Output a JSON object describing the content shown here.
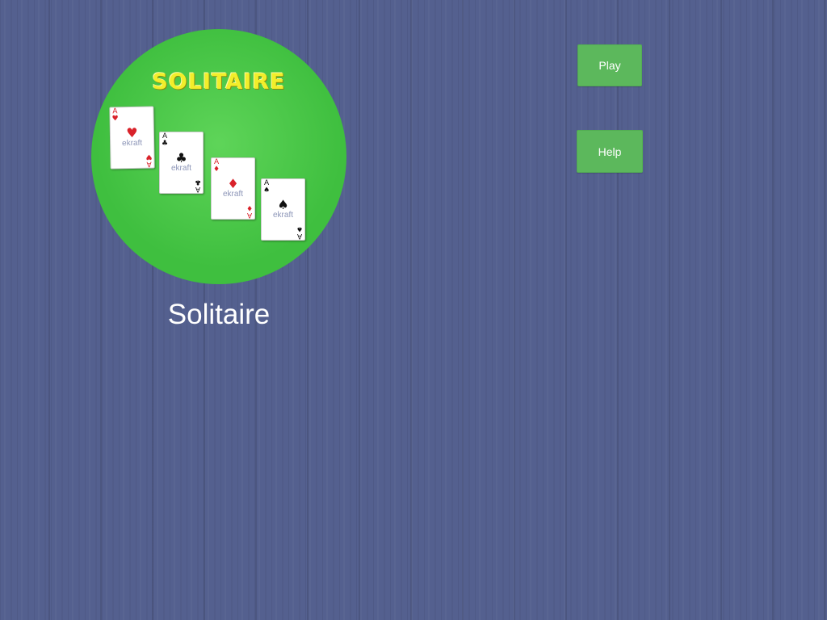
{
  "game": {
    "name": "Solitaire",
    "logo": {
      "title": "SOLITAIRE",
      "cards": [
        {
          "rank": "A",
          "suit": "♥",
          "color": "red",
          "watermark": "ekraft"
        },
        {
          "rank": "A",
          "suit": "♣",
          "color": "black",
          "watermark": "ekraft"
        },
        {
          "rank": "A",
          "suit": "♦",
          "color": "red",
          "watermark": "ekraft"
        },
        {
          "rank": "A",
          "suit": "♠",
          "color": "black",
          "watermark": "ekraft"
        }
      ]
    }
  },
  "menu": {
    "play_label": "Play",
    "help_label": "Help"
  },
  "colors": {
    "background": "#54608f",
    "felt": "#3fbf3f",
    "button": "#5cb85c",
    "logo_title": "#f2ee2a"
  }
}
